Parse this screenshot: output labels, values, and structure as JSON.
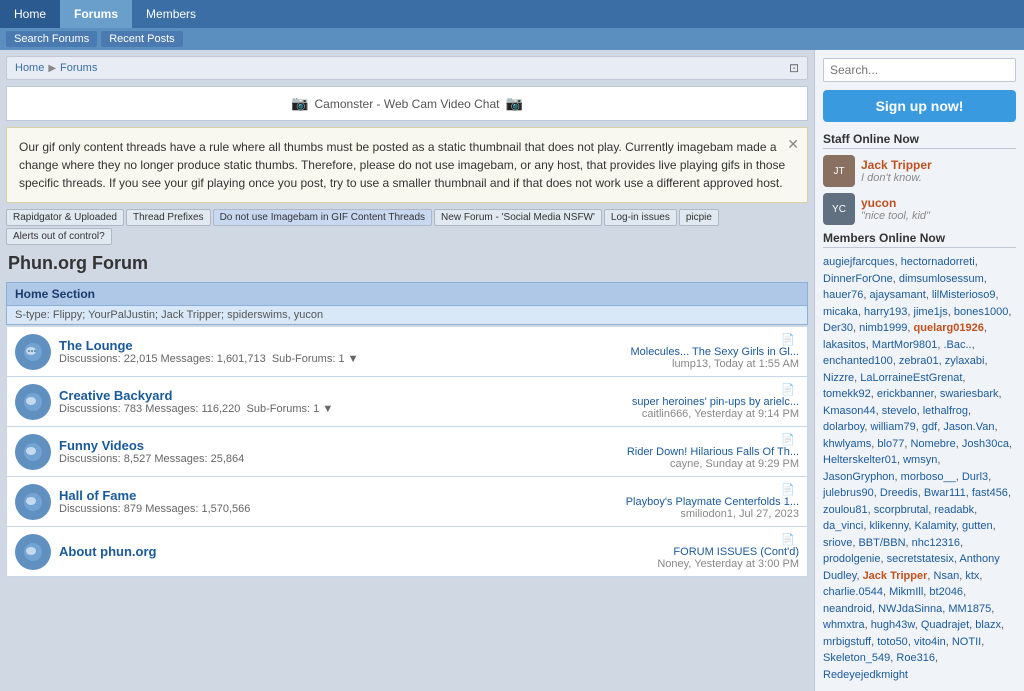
{
  "topNav": {
    "items": [
      {
        "label": "Home",
        "id": "home",
        "active": false
      },
      {
        "label": "Forums",
        "id": "forums",
        "active": true
      },
      {
        "label": "Members",
        "id": "members",
        "active": false
      }
    ]
  },
  "subNav": {
    "items": [
      {
        "label": "Search Forums",
        "id": "search-forums"
      },
      {
        "label": "Recent Posts",
        "id": "recent-posts"
      }
    ]
  },
  "breadcrumb": {
    "home": "Home",
    "forums": "Forums"
  },
  "adBanner": {
    "text": "Camonster - Web Cam Video Chat",
    "icon": "📷"
  },
  "notice": {
    "text": "Our gif only content threads have a rule where all thumbs must be posted as a static thumbnail that does not play. Currently imagebam made a change where they no longer produce static thumbs. Therefore, please do not use imagebam, or any host, that provides live playing gifs in those specific threads. If you see your gif playing once you post, try to use a smaller thumbnail and if that does not work use a different approved host."
  },
  "quickLinks": [
    {
      "label": "Rapidgator & Uploaded",
      "highlight": false
    },
    {
      "label": "Thread Prefixes",
      "highlight": false
    },
    {
      "label": "Do not use Imagebam in GIF Content Threads",
      "highlight": true
    },
    {
      "label": "New Forum - 'Social Media NSFW'",
      "highlight": false
    },
    {
      "label": "Log-in issues",
      "highlight": false
    },
    {
      "label": "picpie",
      "highlight": false
    },
    {
      "label": "Alerts out of control?",
      "highlight": false
    }
  ],
  "forumTitle": "Phun.org Forum",
  "homeSectionHeader": "Home Section",
  "homeSectionSubtext": "S-type: Flippy; YourPalJustin; Jack Tripper; spiderswims, yucon",
  "forums": [
    {
      "name": "The Lounge",
      "discussions": "22,015",
      "messages": "1,601,713",
      "subForums": "1",
      "latest": "Molecules... The Sexy Girls in Gl...",
      "latestBy": "lump13, Today at 1:55 AM"
    },
    {
      "name": "Creative Backyard",
      "discussions": "783",
      "messages": "116,220",
      "subForums": "1",
      "latest": "super heroines' pin-ups by arielc...",
      "latestBy": "caitlin666, Yesterday at 9:14 PM"
    },
    {
      "name": "Funny Videos",
      "discussions": "8,527",
      "messages": "25,864",
      "subForums": "",
      "latest": "Rider Down! Hilarious Falls Of Th...",
      "latestBy": "cayne, Sunday at 9:29 PM"
    },
    {
      "name": "Hall of Fame",
      "discussions": "879",
      "messages": "1,570,566",
      "subForums": "",
      "latest": "Playboy's Playmate Centerfolds 1...",
      "latestBy": "smiliodon1, Jul 27, 2023"
    },
    {
      "name": "About phun.org",
      "discussions": "",
      "messages": "",
      "subForums": "",
      "latest": "FORUM ISSUES (Cont'd)",
      "latestBy": "Noney, Yesterday at 3:00 PM"
    }
  ],
  "sidebar": {
    "searchPlaceholder": "Search...",
    "signupLabel": "Sign up now!",
    "staffTitle": "Staff Online Now",
    "staff": [
      {
        "name": "Jack Tripper",
        "status": "I don't know.",
        "avatarColor": "#8a7060"
      },
      {
        "name": "yucon",
        "status": "\"nice tool, kid\"",
        "avatarColor": "#607080"
      }
    ],
    "membersTitle": "Members Online Now",
    "members": [
      "augiejfarcques",
      "hectornadorreti",
      "DinnerForOne",
      "dimsumlosessum",
      "hauer76",
      "ajaysamant",
      "lilMisterioso9",
      "micaka",
      "harry193",
      "jime1js",
      "bones1000",
      "Der30",
      "nimb1999",
      "quelarg01926",
      "lakasitos",
      "MartMor9801",
      ".Bac..",
      "enchanted100",
      "zebra01",
      "zylaxabi",
      "Nizzre",
      "LaLorraineEstGrenat",
      "tomekk92",
      "erickbanner",
      "swariesbark",
      "Kmason44",
      "stevelo",
      "lethalfrog",
      "dolarboy",
      "william79",
      "gdf",
      "Jason.Van",
      "khwlyams",
      "blo77",
      "Nomebre",
      "Josh30ca",
      "Helterskelter01",
      "wmsyn",
      "JasonGryphon",
      "morboso__",
      "Durl3",
      "julebrus90",
      "Dreedis",
      "Bwar111",
      "fast456",
      "zoulou81",
      "scorpbrutal",
      "readabk",
      "da_vinci",
      "klikenny",
      "Kalamity",
      "gutten",
      "sriove",
      "BBT/BBN",
      "nhc12316",
      "prodolgenie",
      "secretstatesix",
      "Anthony Dudley",
      "Jack Tripper",
      "Nsan",
      "ktx",
      "charlie.0544",
      "MikmIll",
      "bt2046",
      "neandroid",
      "NWJdaSinna",
      "MM1875",
      "whmxtra",
      "hugh43w",
      "Quadrajet",
      "blazx",
      "mrbigstuff",
      "toto50",
      "vito4in",
      "NOTII",
      "Skeleton_549",
      "Roe316",
      "Redeyejedkmight"
    ]
  }
}
